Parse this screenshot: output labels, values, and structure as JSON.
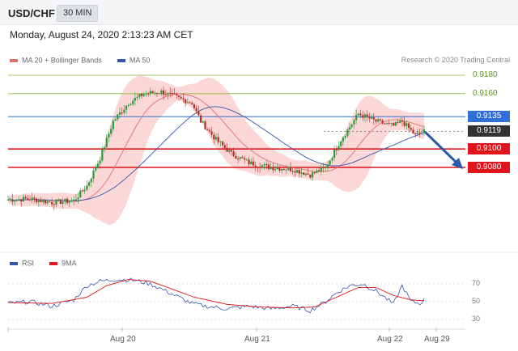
{
  "header": {
    "symbol": "USD/CHF",
    "timeframe": "30 MIN"
  },
  "datetime": "Monday, August 24, 2020 2:13:23 AM CET",
  "legend": {
    "ma20": "MA 20 + Bollinger Bands",
    "ma50": "MA 50",
    "research": "Research © 2020 Trading Central"
  },
  "levels": {
    "r2": "0.9180",
    "r1": "0.9160",
    "pivot": "0.9135",
    "last": "0.9119",
    "s1": "0.9100",
    "s2": "0.9080"
  },
  "rsi_legend": {
    "rsi": "RSI",
    "ma": "9MA"
  },
  "rsi_ticks": [
    "70",
    "50",
    "30"
  ],
  "x_labels": [
    "Aug 20",
    "Aug 21",
    "Aug 22",
    "Aug 29"
  ],
  "colors": {
    "up": "#2e9b3a",
    "down": "#b0302a",
    "bollinger": "#f9c9c9",
    "ma20": "#e07070",
    "ma50": "#3355aa",
    "support": "#e0141b",
    "pivot": "#2f6fd6",
    "resistance": "#8ab43a",
    "last": "#333333",
    "arrow": "#2a5aa8"
  },
  "chart_data": [
    {
      "type": "line",
      "title": "",
      "series": [
        {
          "name": "MA 20 + Bollinger Bands",
          "values": []
        },
        {
          "name": "MA 50",
          "values": []
        }
      ],
      "y_levels": [
        0.918,
        0.916,
        0.9135,
        0.9119,
        0.91,
        0.908
      ],
      "ylim": [
        0.904,
        0.9195
      ],
      "x_labels": [
        "Aug 20",
        "Aug 21",
        "Aug 22",
        "Aug 29"
      ],
      "close_path": [
        [
          0,
          0.9045
        ],
        [
          10,
          0.9046
        ],
        [
          20,
          0.9042
        ],
        [
          30,
          0.9044
        ],
        [
          36,
          0.906
        ],
        [
          42,
          0.909
        ],
        [
          48,
          0.913
        ],
        [
          55,
          0.915
        ],
        [
          62,
          0.916
        ],
        [
          70,
          0.9162
        ],
        [
          78,
          0.9155
        ],
        [
          84,
          0.915
        ],
        [
          88,
          0.913
        ],
        [
          95,
          0.911
        ],
        [
          102,
          0.9095
        ],
        [
          110,
          0.9085
        ],
        [
          120,
          0.908
        ],
        [
          130,
          0.9078
        ],
        [
          138,
          0.9072
        ],
        [
          145,
          0.908
        ],
        [
          152,
          0.911
        ],
        [
          160,
          0.9138
        ],
        [
          168,
          0.913
        ],
        [
          176,
          0.9125
        ],
        [
          180,
          0.913
        ],
        [
          186,
          0.9115
        ],
        [
          190,
          0.9119
        ]
      ]
    },
    {
      "type": "line",
      "title": "",
      "series": [
        {
          "name": "RSI",
          "values": []
        },
        {
          "name": "9MA",
          "values": []
        }
      ],
      "yticks": [
        70,
        50,
        30
      ],
      "ylim": [
        20,
        80
      ],
      "rsi_path": [
        [
          0,
          48
        ],
        [
          10,
          50
        ],
        [
          20,
          45
        ],
        [
          30,
          52
        ],
        [
          36,
          68
        ],
        [
          42,
          73
        ],
        [
          50,
          75
        ],
        [
          58,
          74
        ],
        [
          65,
          70
        ],
        [
          72,
          62
        ],
        [
          78,
          55
        ],
        [
          84,
          48
        ],
        [
          90,
          45
        ],
        [
          100,
          42
        ],
        [
          110,
          45
        ],
        [
          120,
          42
        ],
        [
          130,
          45
        ],
        [
          138,
          40
        ],
        [
          145,
          50
        ],
        [
          150,
          60
        ],
        [
          156,
          68
        ],
        [
          162,
          70
        ],
        [
          168,
          62
        ],
        [
          172,
          55
        ],
        [
          176,
          47
        ],
        [
          180,
          68
        ],
        [
          184,
          50
        ],
        [
          188,
          48
        ],
        [
          190,
          52
        ]
      ],
      "ma_path": [
        [
          0,
          49
        ],
        [
          20,
          48
        ],
        [
          36,
          55
        ],
        [
          45,
          68
        ],
        [
          55,
          75
        ],
        [
          65,
          73
        ],
        [
          75,
          64
        ],
        [
          85,
          55
        ],
        [
          100,
          47
        ],
        [
          115,
          44
        ],
        [
          130,
          43
        ],
        [
          140,
          44
        ],
        [
          150,
          55
        ],
        [
          160,
          66
        ],
        [
          168,
          66
        ],
        [
          176,
          57
        ],
        [
          184,
          52
        ],
        [
          190,
          51
        ]
      ]
    }
  ]
}
